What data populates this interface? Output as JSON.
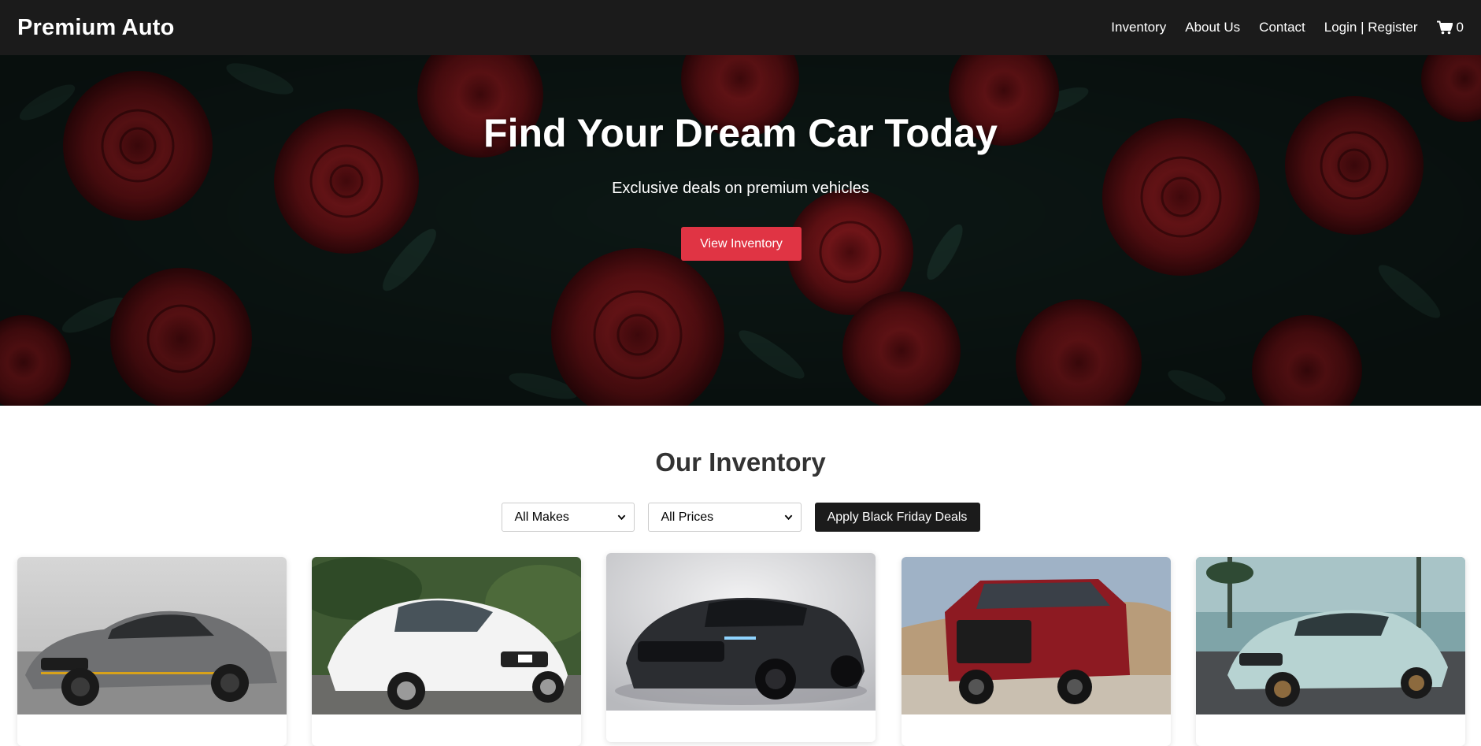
{
  "navbar": {
    "brand": "Premium Auto",
    "links": [
      "Inventory",
      "About Us",
      "Contact",
      "Login | Register"
    ],
    "cart_count": "0",
    "cart_icon": "shopping-cart-icon"
  },
  "hero": {
    "title": "Find Your Dream Car Today",
    "subtitle": "Exclusive deals on premium vehicles",
    "button": "View Inventory"
  },
  "inventory": {
    "title": "Our Inventory",
    "make_filter": "All Makes",
    "price_filter": "All Prices",
    "deals_button": "Apply Black Friday Deals"
  },
  "colors": {
    "accent": "#e03444",
    "navbar": "#1b1b1b",
    "roses": "#7a1418"
  }
}
